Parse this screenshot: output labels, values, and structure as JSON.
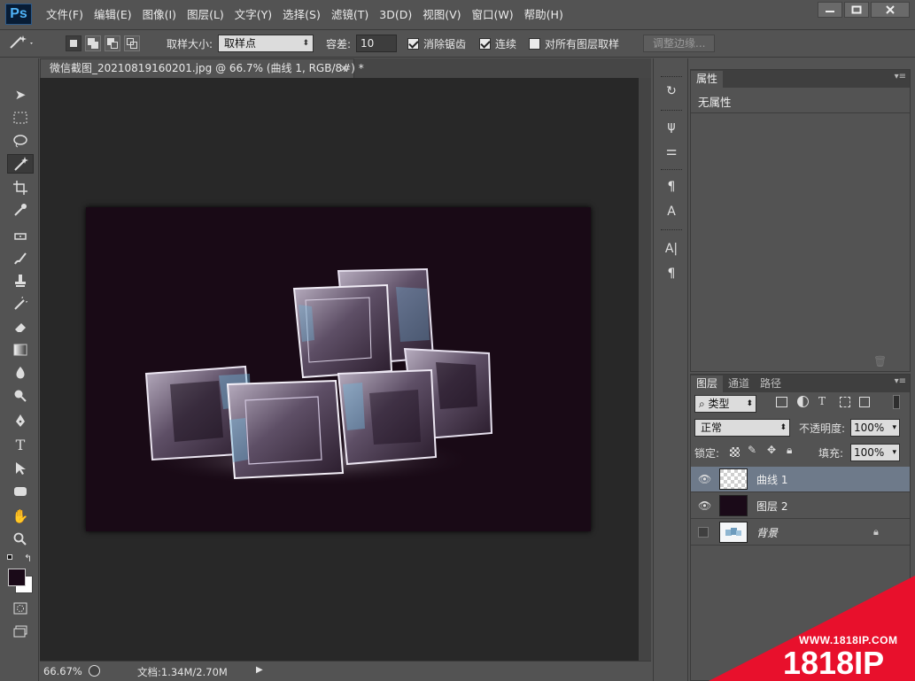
{
  "app": {
    "logo": "Ps",
    "menus": [
      "文件(F)",
      "编辑(E)",
      "图像(I)",
      "图层(L)",
      "文字(Y)",
      "选择(S)",
      "滤镜(T)",
      "3D(D)",
      "视图(V)",
      "窗口(W)",
      "帮助(H)"
    ]
  },
  "options": {
    "sample_size_label": "取样大小:",
    "sample_size_value": "取样点",
    "tolerance_label": "容差:",
    "tolerance_value": "10",
    "antialias_label": "消除锯齿",
    "contiguous_label": "连续",
    "all_layers_label": "对所有图层取样",
    "refine_edge_label": "调整边缘..."
  },
  "document": {
    "tab_title": "微信截图_20210819160201.jpg @ 66.7% (曲线 1, RGB/8#) *",
    "close_glyph": "×",
    "zoom": "66.67%",
    "doc_info": "文档:1.34M/2.70M"
  },
  "properties": {
    "tab": "属性",
    "content": "无属性"
  },
  "layers_panel": {
    "tabs": [
      "图层",
      "通道",
      "路径"
    ],
    "filter_label": "类型",
    "blend_mode": "正常",
    "opacity_label": "不透明度:",
    "opacity_value": "100%",
    "lock_label": "锁定:",
    "fill_label": "填充:",
    "fill_value": "100%",
    "layers": [
      {
        "name": "曲线 1",
        "visible": true,
        "selected": true
      },
      {
        "name": "图层 2",
        "visible": true,
        "selected": false
      },
      {
        "name": "背景",
        "visible": false,
        "selected": false,
        "locked": true
      }
    ]
  },
  "watermark": {
    "url": "WWW.1818IP.COM",
    "brand": "1818IP"
  },
  "colors": {
    "foreground": "#1a0a18",
    "background": "#ffffff",
    "canvas_fill": "#190a16",
    "watermark_red": "#e8102c"
  }
}
